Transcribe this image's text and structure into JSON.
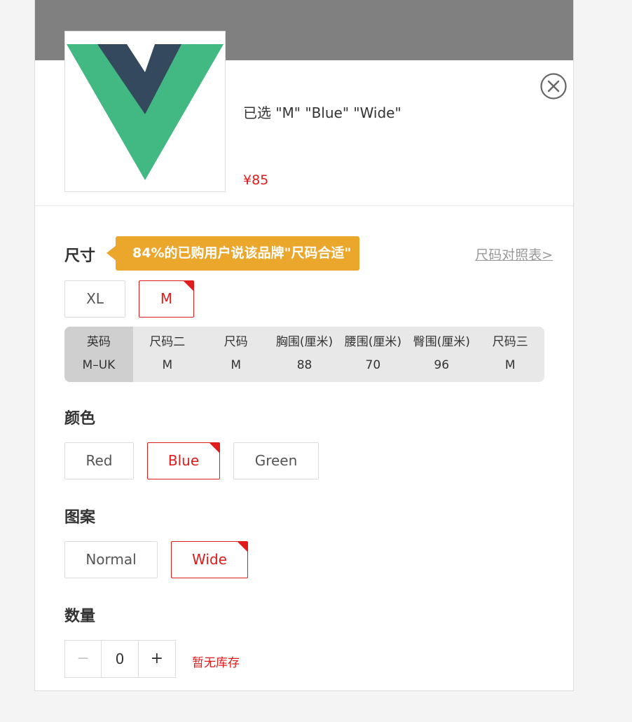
{
  "product": {
    "selected_text": "已选 \"M\" \"Blue\" \"Wide\"",
    "price": "¥85",
    "image_icon": "vue-logo-icon"
  },
  "size": {
    "title": "尺寸",
    "tip": "84%的已购用户说该品牌\"尺码合适\"",
    "chart_link": "尺码对照表>",
    "options": [
      "XL",
      "M"
    ],
    "selected": "M"
  },
  "size_table": {
    "columns": [
      {
        "header": "英码",
        "value": "M–UK"
      },
      {
        "header": "尺码二",
        "value": "M"
      },
      {
        "header": "尺码",
        "value": "M"
      },
      {
        "header": "胸围(厘米)",
        "value": "88"
      },
      {
        "header": "腰围(厘米)",
        "value": "70"
      },
      {
        "header": "臀围(厘米)",
        "value": "96"
      },
      {
        "header": "尺码三",
        "value": "M"
      }
    ]
  },
  "color": {
    "title": "颜色",
    "options": [
      "Red",
      "Blue",
      "Green"
    ],
    "selected": "Blue"
  },
  "pattern": {
    "title": "图案",
    "options": [
      "Normal",
      "Wide"
    ],
    "selected": "Wide"
  },
  "quantity": {
    "title": "数量",
    "minus": "−",
    "value": "0",
    "plus": "+",
    "stock_status": "暂无库存"
  },
  "colors": {
    "accent": "#e01b1b",
    "tip_bg": "#eba72b",
    "vue_green": "#42b883",
    "vue_dark": "#35495e"
  }
}
